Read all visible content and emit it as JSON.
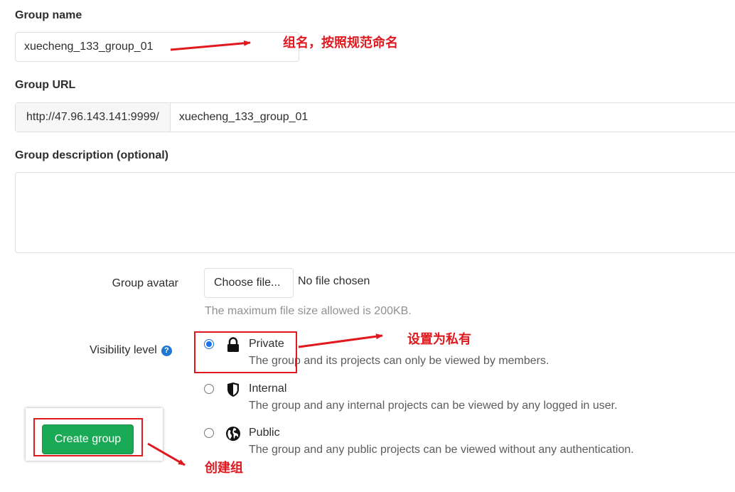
{
  "group_name": {
    "label": "Group name",
    "value": "xuecheng_133_group_01"
  },
  "group_url": {
    "label": "Group URL",
    "prefix": "http://47.96.143.141:9999/",
    "path": "xuecheng_133_group_01"
  },
  "group_description": {
    "label": "Group description (optional)",
    "value": ""
  },
  "avatar": {
    "label": "Group avatar",
    "button": "Choose file...",
    "status": "No file chosen",
    "hint": "The maximum file size allowed is 200KB."
  },
  "visibility": {
    "label": "Visibility level",
    "options": [
      {
        "title": "Private",
        "desc": "The group and its projects can only be viewed by members.",
        "icon": "lock-icon",
        "checked": true
      },
      {
        "title": "Internal",
        "desc": "The group and any internal projects can be viewed by any logged in user.",
        "icon": "shield-icon",
        "checked": false
      },
      {
        "title": "Public",
        "desc": "The group and any public projects can be viewed without any authentication.",
        "icon": "globe-icon",
        "checked": false
      }
    ]
  },
  "submit": {
    "label": "Create group"
  },
  "annotations": {
    "name": "组名，按照规范命名",
    "private": "设置为私有",
    "create": "创建组"
  },
  "colors": {
    "annotation_red": "#e0191f",
    "create_green": "#1aaa55",
    "radio_blue": "#1a73e8",
    "help_blue": "#1f78d1"
  }
}
